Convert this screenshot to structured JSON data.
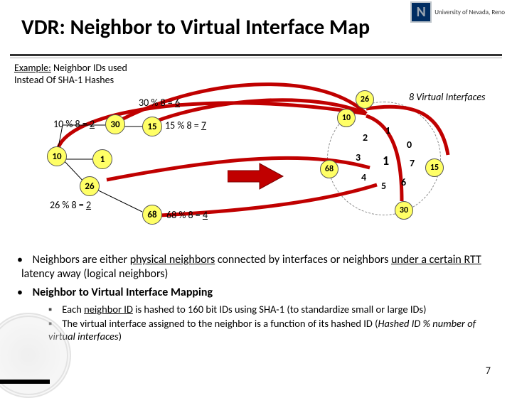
{
  "header": {
    "title": "VDR: Neighbor to Virtual Interface Map",
    "logo_letter": "N",
    "logo_text": "University of Nevada, Reno"
  },
  "example": {
    "line1": "Example:",
    "line2": " Neighbor IDs used",
    "line3": "Instead Of SHA-1 Hashes"
  },
  "neighbors": {
    "n30": "30",
    "n15": "15",
    "n10": "10",
    "n1": "1",
    "n26": "26",
    "n68": "68"
  },
  "mod": {
    "m30": {
      "pre": "30 % 8 = ",
      "res": "6"
    },
    "m10": {
      "pre": "10 % 8 = ",
      "res": "2"
    },
    "m15": {
      "pre": "15 % 8 = ",
      "res": "7"
    },
    "m26": {
      "pre": "26 % 8 = ",
      "res": "2"
    },
    "m68": {
      "pre": "68 % 8 = ",
      "res": "4"
    }
  },
  "ring": {
    "title": "8 Virtual Interfaces",
    "center": "1",
    "slots": [
      "0",
      "1",
      "2",
      "3",
      "4",
      "5",
      "6",
      "7"
    ],
    "mapped": {
      "s1": "26",
      "s2": "10",
      "s4": "68",
      "s6": "30",
      "s7": "15"
    }
  },
  "bullets": {
    "b1a": "Neighbors are either ",
    "b1b": "physical neighbors",
    "b1c": " connected by interfaces or neighbors ",
    "b1d": "under a certain RTT",
    "b1e": " latency away (logical neighbors)",
    "b2": "Neighbor to Virtual Interface Mapping",
    "s1a": "Each ",
    "s1b": "neighbor ID",
    "s1c": " is hashed to 160 bit IDs using SHA-1 (to standardize small or large IDs)",
    "s2a": "The virtual interface assigned to the neighbor is a function of its hashed ID (",
    "s2b": "Hashed ID % number of virtual interfaces",
    "s2c": ")"
  },
  "page": "7"
}
